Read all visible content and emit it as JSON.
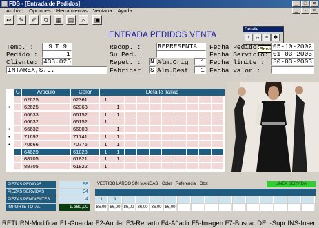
{
  "window": {
    "title": "FDS - [Entrada de Pedidos]"
  },
  "menu": [
    "Archivo",
    "Opciones",
    "Herramientas",
    "Ventana",
    "Ayuda"
  ],
  "banner": "ENTRADA PEDIDOS VENTA",
  "detalle_popup": {
    "title": "Detalle",
    "tooltip": "Servicio"
  },
  "form": {
    "temp_label": "Temp. :",
    "temp_value": "9",
    "temp_code": "T.9",
    "pedido_label": "Pedido :",
    "pedido_value": "1",
    "cliente_label": "Cliente:",
    "cliente_value": "433.025",
    "cliente_name": "INTAREX,S.L.",
    "recop_label": "Recop.  :",
    "recop_value": "REPRESENTA",
    "suped_label": "Su Ped. :",
    "suped_value": "",
    "repet_label": "Repet.  :",
    "repet_value": "N",
    "almorig_label": "Alm.Orig",
    "almorig_value": "1",
    "fabricar_label": "Fabricar:",
    "fabricar_value": "S",
    "almdest_label": "Alm.Dest",
    "almdest_value": "1",
    "fpedido_label": "Fecha Pedido:",
    "fpedido_value": "05-10-2002",
    "fservicio_label": "Fecha Servicio:",
    "fservicio_value": "01-03-2003",
    "flimite_label": "Fecha limite :",
    "flimite_value": "30-03-2003",
    "fvalor_label": "Fecha valor  :",
    "fvalor_value": ""
  },
  "grid": {
    "headers": {
      "g": "G",
      "articulo": "Articulo",
      "color": "Color",
      "tallas": "Detalle Tallas"
    },
    "rows": [
      {
        "mark": "",
        "articulo": "62625",
        "color": "62361",
        "t1": "1",
        "t2": "",
        "sel": false
      },
      {
        "mark": "•",
        "articulo": "62625",
        "color": "62363",
        "t1": "",
        "t2": "1",
        "sel": false
      },
      {
        "mark": "",
        "articulo": "66633",
        "color": "66152",
        "t1": "1",
        "t2": "1",
        "sel": false
      },
      {
        "mark": "",
        "articulo": "66632",
        "color": "66152",
        "t1": "1",
        "t2": "",
        "sel": false
      },
      {
        "mark": "•",
        "articulo": "66632",
        "color": "66003",
        "t1": "",
        "t2": "1",
        "sel": false
      },
      {
        "mark": "•",
        "articulo": "71692",
        "color": "71741",
        "t1": "1",
        "t2": "1",
        "sel": false
      },
      {
        "mark": "•",
        "articulo": "70666",
        "color": "70776",
        "t1": "1",
        "t2": "1",
        "sel": false
      },
      {
        "mark": "",
        "articulo": "64629",
        "color": "61823",
        "t1": "1",
        "t2": "1",
        "sel": true
      },
      {
        "mark": "",
        "articulo": "88705",
        "color": "61821",
        "t1": "1",
        "t2": "1",
        "sel": false
      },
      {
        "mark": "",
        "articulo": "88705",
        "color": "61822",
        "t1": "1",
        "t2": "",
        "sel": false
      }
    ]
  },
  "totals": {
    "pedidas_label": "PIEZAS PEDIDAS",
    "pedidas_value": "98",
    "servidas_label": "PIEZAS SERVIDAS",
    "servidas_value": "94",
    "pendientes_label": "PIEZAS PENDIENTES",
    "pendientes_value": "4",
    "importe_label": "IMPORTE TOTAL",
    "importe_value": "1.680,00"
  },
  "articulo_info": {
    "desc": "VESTIDO LARGO SIN MANGAS",
    "color_label": "Color",
    "ref_label": "Referencia",
    "obs_label": "Obs:",
    "linea": "LINEA SERVIDA",
    "qty": [
      "1",
      "1",
      "",
      "",
      "",
      ""
    ],
    "prices": [
      "86,00",
      "86,00",
      "86,00",
      "86,00",
      "86,00",
      "86,00"
    ]
  },
  "statusbar": "RETURN-Modificar F1-Guardar F2-Anular F3-Reparto F4-Añadir F5-Imagen F7-Buscar DEL-Supr INS-Inser",
  "colors": {
    "titlebar": "#0a246a",
    "grid_header": "#1f5c80",
    "row_pink": "#f2d9d7",
    "row_selected": "#1f5c80",
    "banner": "#1a1aa6"
  }
}
